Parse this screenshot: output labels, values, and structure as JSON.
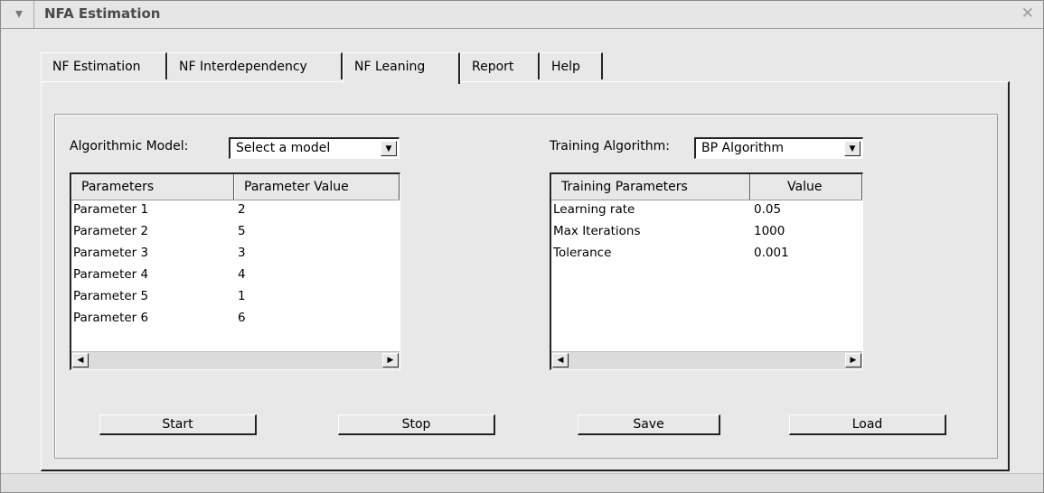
{
  "window": {
    "title": "NFA Estimation"
  },
  "tabs": [
    {
      "label": "NF Estimation"
    },
    {
      "label": "NF Interdependency"
    },
    {
      "label": "NF Leaning",
      "active": true
    },
    {
      "label": "Report"
    },
    {
      "label": "Help"
    }
  ],
  "left": {
    "label": "Algorithmic Model:",
    "select_value": "Select a model",
    "columns": [
      "Parameters",
      "Parameter Value"
    ],
    "rows": [
      [
        "Parameter 1",
        "2"
      ],
      [
        "Parameter 2",
        "5"
      ],
      [
        "Parameter 3",
        "3"
      ],
      [
        "Parameter 4",
        "4"
      ],
      [
        "Parameter 5",
        "1"
      ],
      [
        "Parameter 6",
        "6"
      ]
    ]
  },
  "right": {
    "label": "Training Algorithm:",
    "select_value": "BP Algorithm",
    "columns": [
      "Training Parameters",
      "Value"
    ],
    "rows": [
      [
        "Learning rate",
        "0.05"
      ],
      [
        "Max Iterations",
        "1000"
      ],
      [
        "Tolerance",
        "0.001"
      ]
    ]
  },
  "buttons": {
    "start": "Start",
    "stop": "Stop",
    "save": "Save",
    "load": "Load"
  },
  "icons": {
    "window_menu": "chevron-down-icon",
    "close": "close-icon",
    "combo_arrow": "triangle-down-icon",
    "scroll_left": "arrow-left-icon",
    "scroll_right": "arrow-right-icon"
  }
}
